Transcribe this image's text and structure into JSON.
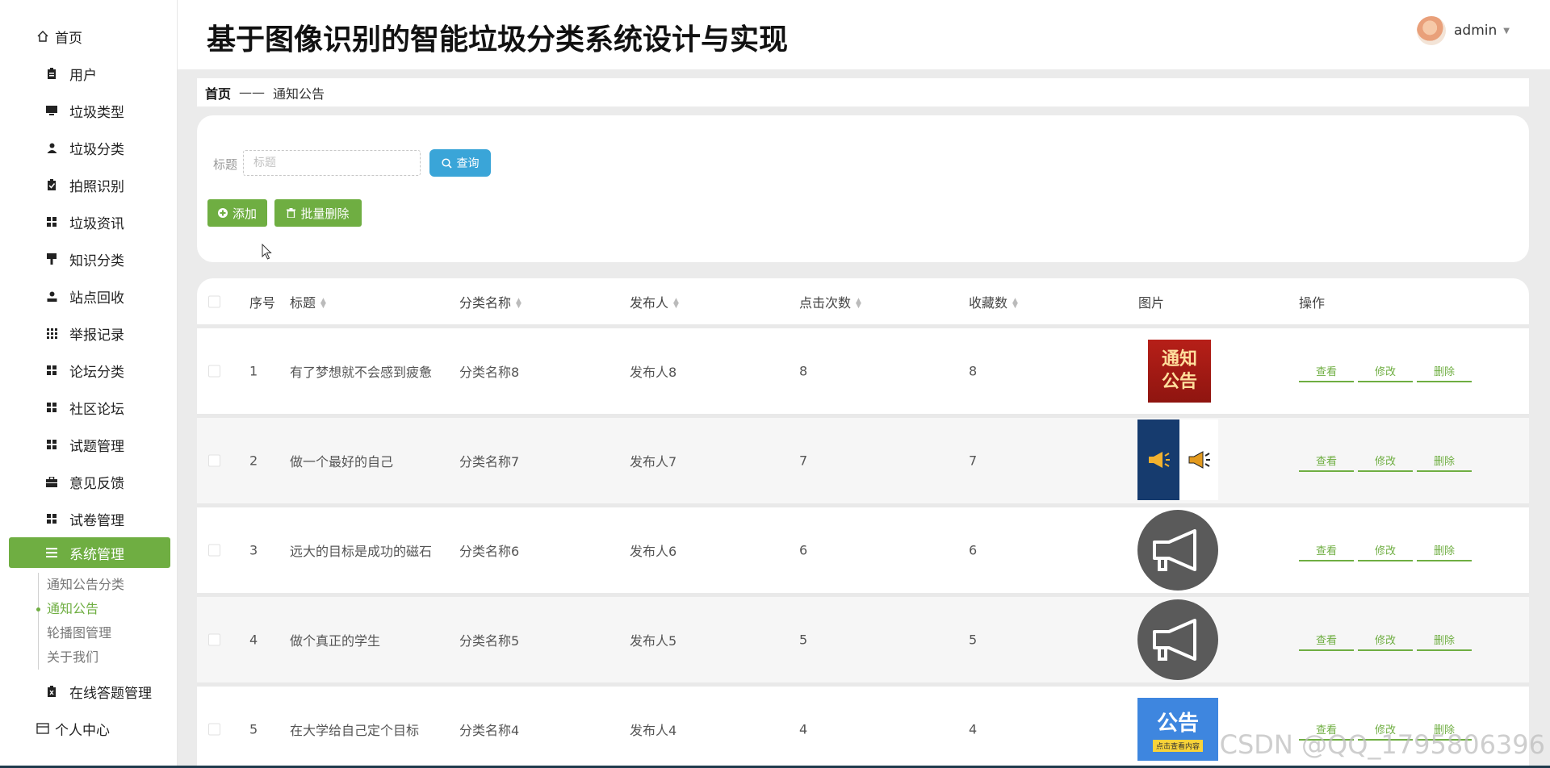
{
  "header": {
    "title": "基于图像识别的智能垃圾分类系统设计与实现",
    "username": "admin"
  },
  "sidebar": {
    "home": "首页",
    "items": [
      "用户",
      "垃圾类型",
      "垃圾分类",
      "拍照识别",
      "垃圾资讯",
      "知识分类",
      "站点回收",
      "举报记录",
      "论坛分类",
      "社区论坛",
      "试题管理",
      "意见反馈",
      "试卷管理"
    ],
    "active": "系统管理",
    "sub_items": [
      "通知公告分类",
      "通知公告",
      "轮播图管理",
      "关于我们"
    ],
    "after_items": [
      "在线答题管理"
    ],
    "personal": "个人中心"
  },
  "breadcrumb": {
    "home": "首页",
    "sep": "——",
    "current": "通知公告"
  },
  "search": {
    "label": "标题",
    "placeholder": "标题",
    "value": "",
    "button": "查询"
  },
  "actions": {
    "add": "添加",
    "batch_delete": "批量删除"
  },
  "table": {
    "headers": [
      "序号",
      "标题",
      "分类名称",
      "发布人",
      "点击次数",
      "收藏数",
      "图片",
      "操作"
    ],
    "rows": [
      {
        "idx": "1",
        "title": "有了梦想就不会感到疲惫",
        "category": "分类名称8",
        "publisher": "发布人8",
        "clicks": "8",
        "favs": "8",
        "image": "notice-red"
      },
      {
        "idx": "2",
        "title": "做一个最好的自己",
        "category": "分类名称7",
        "publisher": "发布人7",
        "clicks": "7",
        "favs": "7",
        "image": "horn-blue"
      },
      {
        "idx": "3",
        "title": "远大的目标是成功的磁石",
        "category": "分类名称6",
        "publisher": "发布人6",
        "clicks": "6",
        "favs": "6",
        "image": "megaphone-gray"
      },
      {
        "idx": "4",
        "title": "做个真正的学生",
        "category": "分类名称5",
        "publisher": "发布人5",
        "clicks": "5",
        "favs": "5",
        "image": "megaphone-gray"
      },
      {
        "idx": "5",
        "title": "在大学给自己定个目标",
        "category": "分类名称4",
        "publisher": "发布人4",
        "clicks": "4",
        "favs": "4",
        "image": "notice-blue"
      }
    ],
    "ops": [
      "查看",
      "修改",
      "删除"
    ],
    "image_text": {
      "notice_red_1": "通知",
      "notice_red_2": "公告",
      "notice_blue": "公告",
      "notice_blue_bar": "点击查看内容"
    }
  },
  "watermark": "CSDN @QQ_1795806396",
  "colors": {
    "primary": "#6fae42",
    "query": "#3aa5d8"
  }
}
